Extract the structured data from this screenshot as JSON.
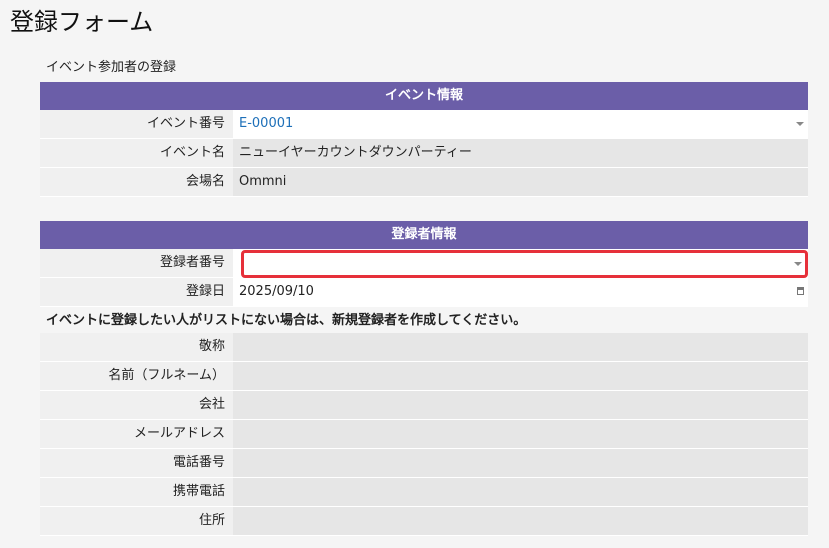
{
  "title": "登録フォーム",
  "subtitle": "イベント参加者の登録",
  "event_section": {
    "header": "イベント情報",
    "fields": [
      {
        "label": "イベント番号",
        "value": "E-00001"
      },
      {
        "label": "イベント名",
        "value": "ニューイヤーカウントダウンパーティー"
      },
      {
        "label": "会場名",
        "value": "Ommni"
      }
    ]
  },
  "registrant_section": {
    "header": "登録者情報",
    "fields": [
      {
        "label": "登録者番号",
        "value": ""
      },
      {
        "label": "登録日",
        "value": "2025/09/10"
      }
    ]
  },
  "notice": "イベントに登録したい人がリストにない場合は、新規登録者を作成してください。",
  "new_registrant": {
    "fields": [
      {
        "label": "敬称",
        "value": ""
      },
      {
        "label": "名前（フルネーム）",
        "value": ""
      },
      {
        "label": "会社",
        "value": ""
      },
      {
        "label": "メールアドレス",
        "value": ""
      },
      {
        "label": "電話番号",
        "value": ""
      },
      {
        "label": "携帯電話",
        "value": ""
      },
      {
        "label": "住所",
        "value": ""
      }
    ]
  },
  "colors": {
    "header_bg": "#6b5ea8",
    "link": "#1d6fb8",
    "highlight": "#e6303a"
  }
}
